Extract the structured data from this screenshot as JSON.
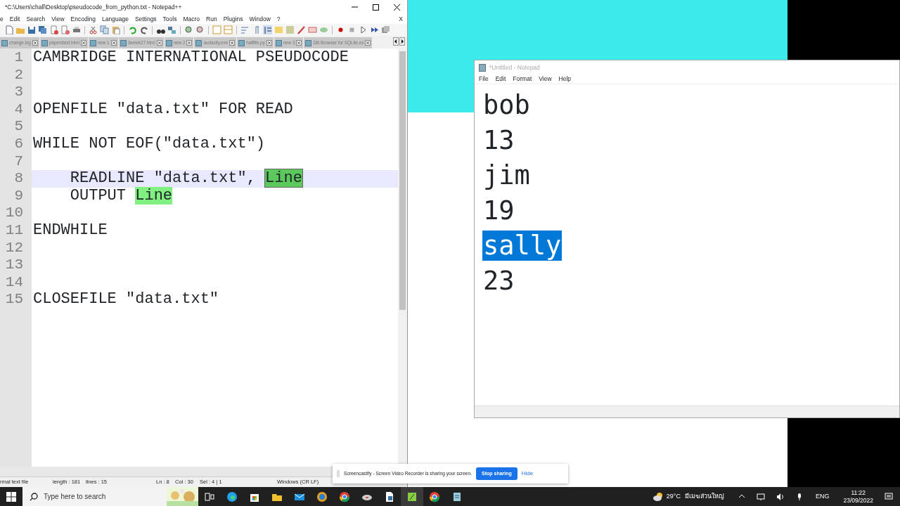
{
  "notepadpp": {
    "title": "*C:\\Users\\chall\\Desktop\\pseudocode_from_python.txt - Notepad++",
    "menu": [
      "e",
      "Edit",
      "Search",
      "View",
      "Encoding",
      "Language",
      "Settings",
      "Tools",
      "Macro",
      "Run",
      "Plugins",
      "Window",
      "?"
    ],
    "menu_close": "X",
    "tabs": [
      {
        "label": "change.log"
      },
      {
        "label": "paperstest.html"
      },
      {
        "label": "new 1"
      },
      {
        "label": "3week27.html"
      },
      {
        "label": "new 2"
      },
      {
        "label": "audacity.exe"
      },
      {
        "label": "halflife.py"
      },
      {
        "label": "new 3"
      },
      {
        "label": "DB Browser for SQLite.ex"
      }
    ],
    "lines": [
      {
        "number": "1",
        "current": false,
        "segments": [
          {
            "text": "CAMBRIDGE INTERNATIONAL PSEUDOCODE"
          }
        ]
      },
      {
        "number": "2",
        "current": false
      },
      {
        "number": "3",
        "current": false
      },
      {
        "number": "4",
        "current": false,
        "segments": [
          {
            "text": "OPENFILE \"data.txt\" FOR READ"
          }
        ]
      },
      {
        "number": "5",
        "current": false
      },
      {
        "number": "6",
        "current": false,
        "segments": [
          {
            "text": "WHILE NOT EOF(\"data.txt\")"
          }
        ]
      },
      {
        "number": "7",
        "current": false
      },
      {
        "number": "8",
        "current": true,
        "segments": [
          {
            "text": "    READLINE \"data.txt\", ",
            "highlighted": false,
            "selected": false
          },
          {
            "text": "Line",
            "highlighted": true,
            "selected": true
          }
        ]
      },
      {
        "number": "9",
        "current": false,
        "segments": [
          {
            "text": "    OUTPUT ",
            "highlighted": false,
            "selected": false
          },
          {
            "text": "Line",
            "highlighted": true,
            "selected": false
          }
        ]
      },
      {
        "number": "10",
        "current": false
      },
      {
        "number": "11",
        "current": false,
        "segments": [
          {
            "text": "ENDWHILE"
          }
        ]
      },
      {
        "number": "12",
        "current": false
      },
      {
        "number": "13",
        "current": false
      },
      {
        "number": "14",
        "current": false
      },
      {
        "number": "15",
        "current": false,
        "segments": [
          {
            "text": "CLOSEFILE \"data.txt\""
          }
        ]
      }
    ],
    "status_bar": [
      "rmal text file",
      "length : 181",
      "lines : 15",
      "Ln : 8",
      "Col : 30",
      "Sel : 4 | 1",
      "Windows (CR LF)"
    ]
  },
  "notepad": {
    "title": "*Untitled - Notepad",
    "menu": [
      "File",
      "Edit",
      "Format",
      "View",
      "Help"
    ],
    "lines": [
      {
        "text": "bob",
        "selected": false
      },
      {
        "text": "13",
        "selected": false
      },
      {
        "text": "jim",
        "selected": false
      },
      {
        "text": "19",
        "selected": false
      },
      {
        "text": "sally",
        "selected": true
      },
      {
        "text": "23",
        "selected": false
      }
    ]
  },
  "screencastify": {
    "message": "Screencastify - Screen Video Recorder is sharing your screen.",
    "button": "Stop sharing",
    "link": "Hide"
  },
  "taskbar": {
    "search_placeholder": "Type here to search",
    "temperature": "29°C",
    "weather": "มีเมฆส่วนใหญ่",
    "language": "ENG",
    "time": "11:22",
    "date": "23/09/2022"
  }
}
